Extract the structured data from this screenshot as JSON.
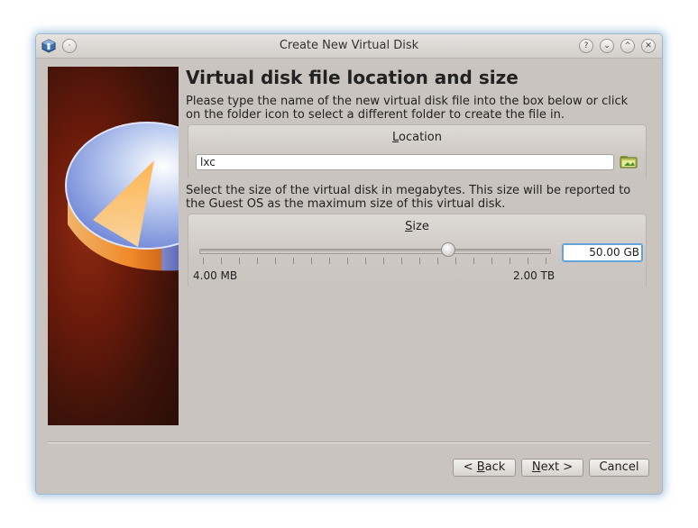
{
  "window": {
    "title": "Create New Virtual Disk"
  },
  "titlebar_buttons": [
    "?",
    "⌄",
    "^",
    "✕"
  ],
  "heading": "Virtual disk file location and size",
  "location": {
    "description": "Please type the name of the new virtual disk file into the box below or click on the folder icon to select a different folder to create the file in.",
    "group_title_prefix": "",
    "group_title_mnemonic": "L",
    "group_title_rest": "ocation",
    "value": "lxc"
  },
  "size": {
    "description": "Select the size of the virtual disk in megabytes. This size will be reported to the Guest OS as the maximum size of this virtual disk.",
    "group_title_mnemonic": "S",
    "group_title_rest": "ize",
    "min_label": "4.00 MB",
    "max_label": "2.00 TB",
    "value": "50.00 GB",
    "slider_fraction": 0.71
  },
  "buttons": {
    "back_prefix": "< ",
    "back_mnemonic": "B",
    "back_rest": "ack",
    "next_mnemonic": "N",
    "next_rest": "ext >",
    "cancel": "Cancel"
  },
  "colors": {
    "accent": "#62a3d9",
    "side_panel": "#6a1a0a"
  }
}
